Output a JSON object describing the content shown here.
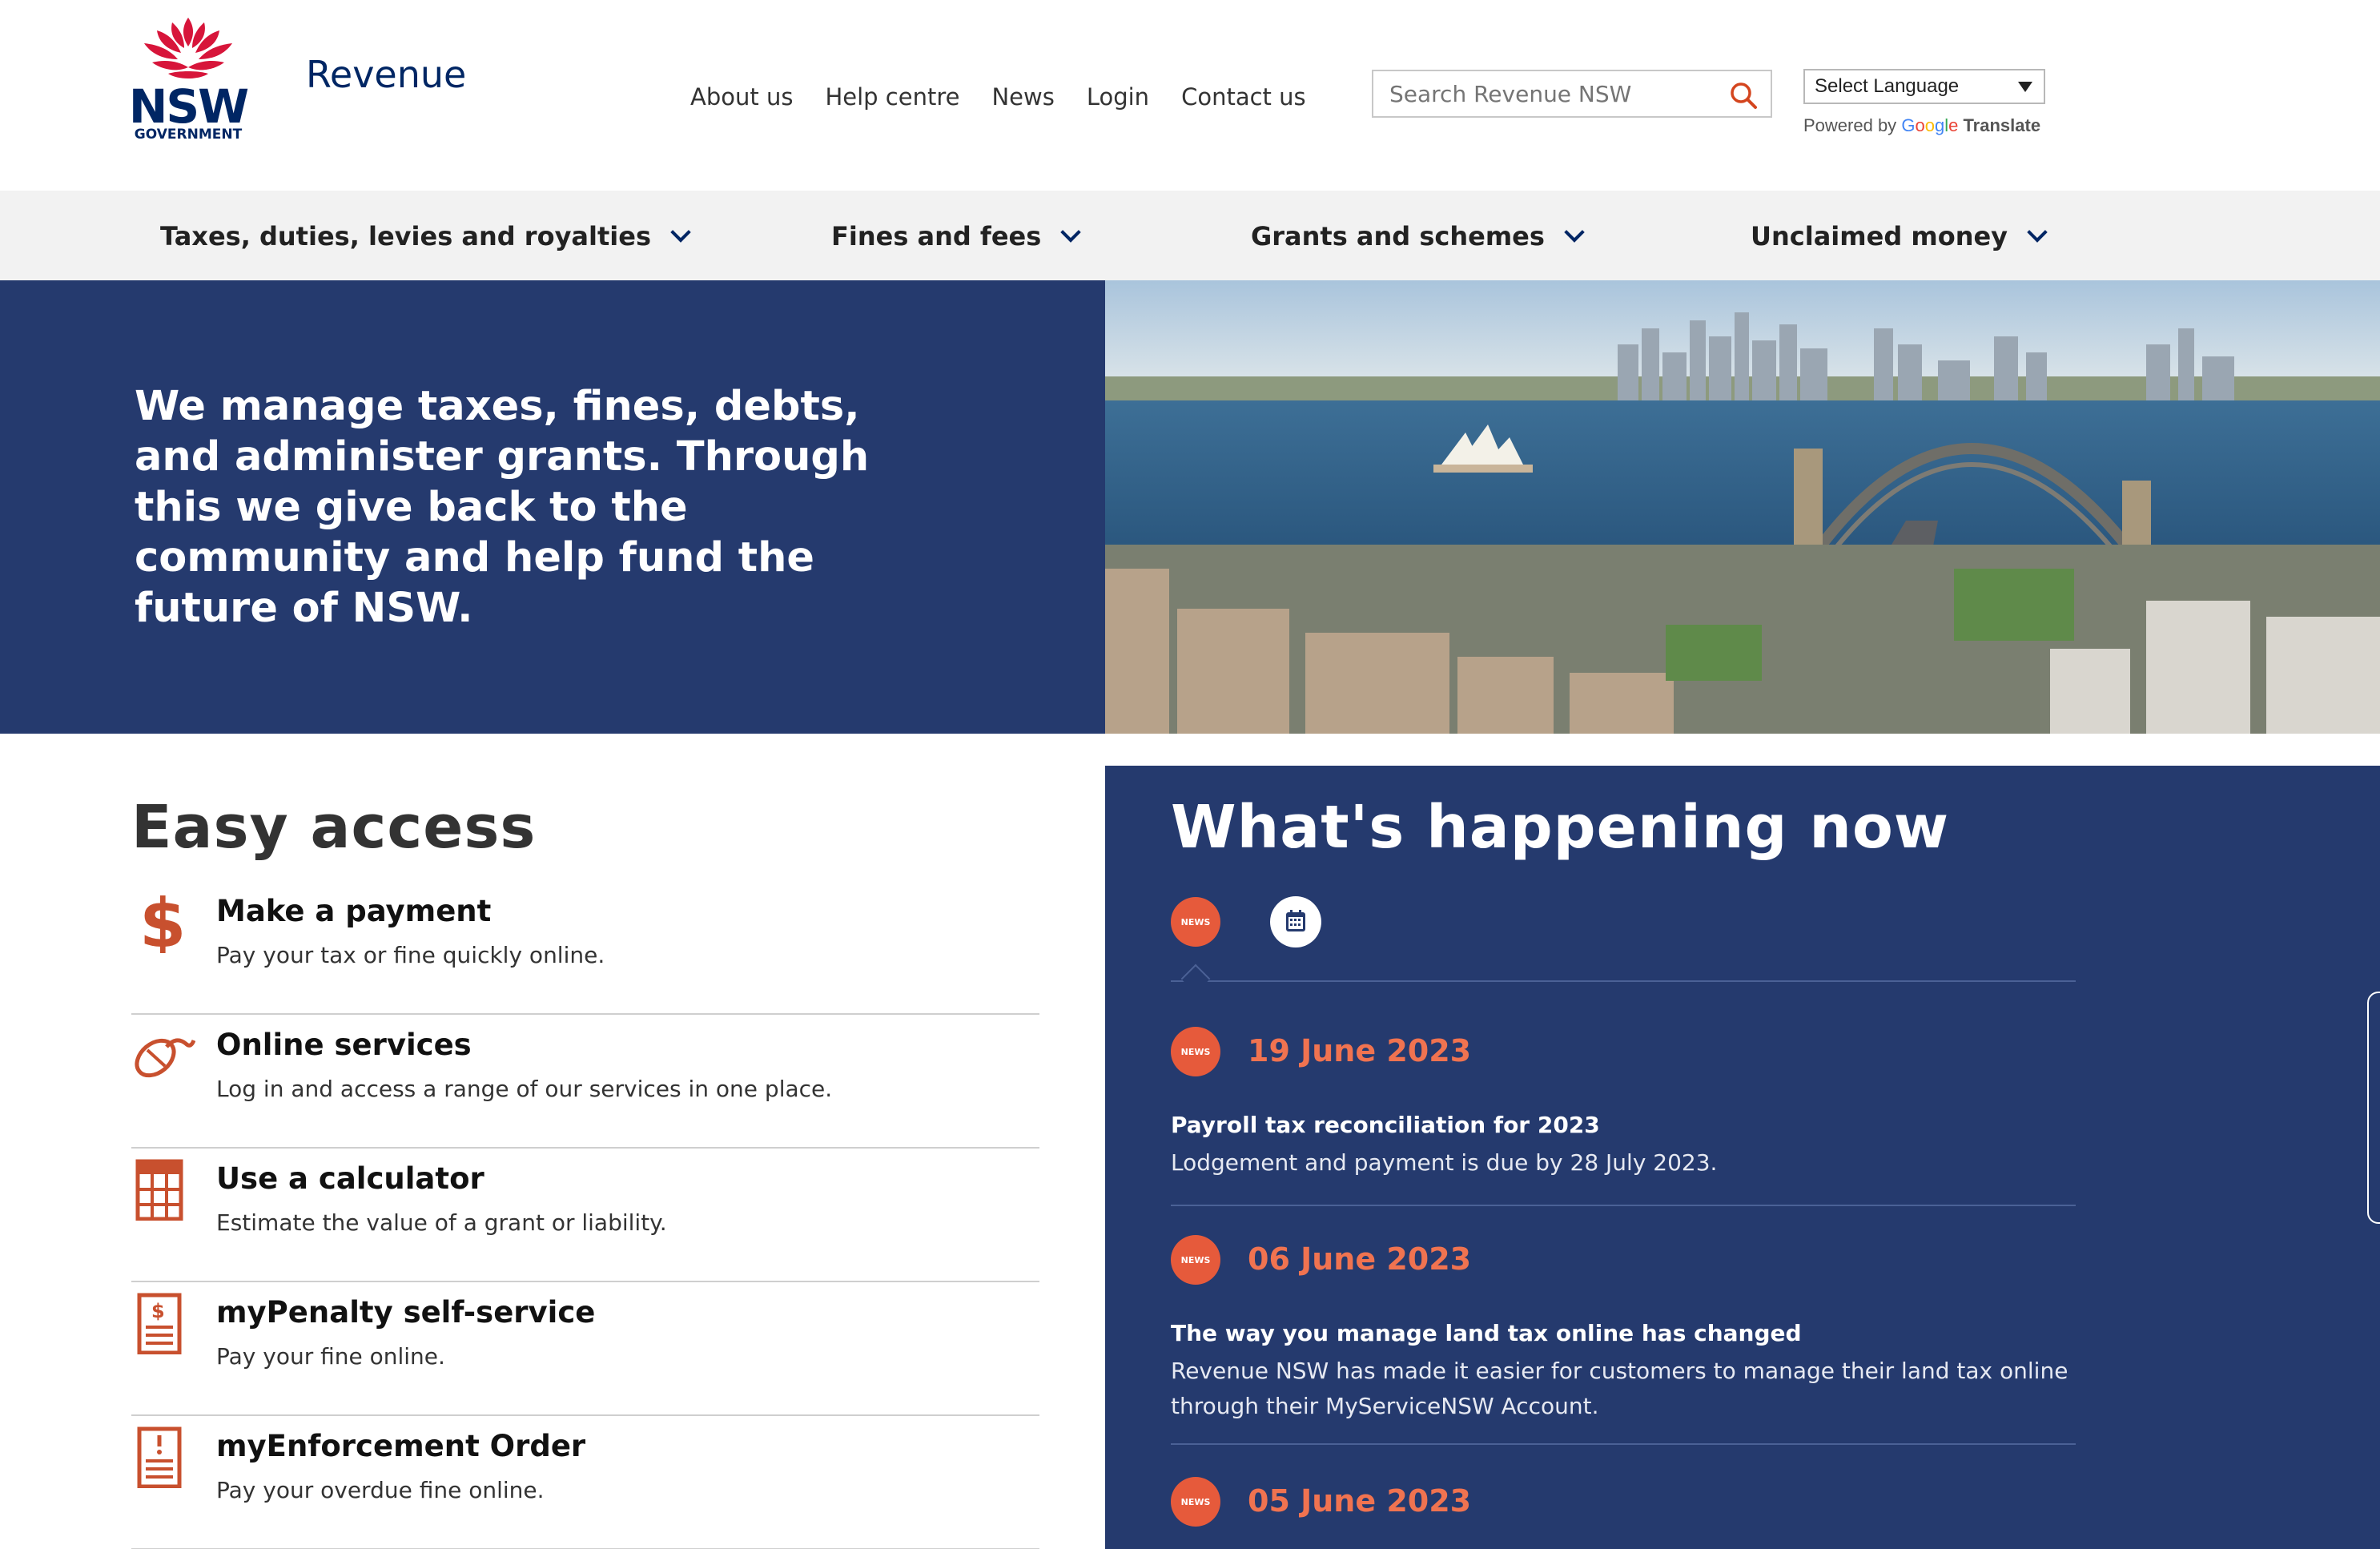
{
  "brand": {
    "logo_text": "NSW",
    "logo_subtext": "GOVERNMENT",
    "site_name": "Revenue"
  },
  "topnav": {
    "items": [
      "About us",
      "Help centre",
      "News",
      "Login",
      "Contact us"
    ]
  },
  "search": {
    "placeholder": "Search Revenue NSW",
    "icon": "search-icon"
  },
  "translate": {
    "select_label": "Select Language",
    "powered_by": "Powered by",
    "google": "Google",
    "translate": "Translate"
  },
  "mainnav": {
    "items": [
      "Taxes, duties, levies and royalties",
      "Fines and fees",
      "Grants and schemes",
      "Unclaimed money"
    ]
  },
  "hero": {
    "heading": "We manage taxes, fines, debts, and administer grants. Through this we give back to the community and help fund the future of NSW."
  },
  "easy_access": {
    "heading": "Easy access",
    "items": [
      {
        "title": "Make a payment",
        "desc": "Pay your tax or fine quickly online.",
        "icon": "dollar-icon"
      },
      {
        "title": "Online services",
        "desc": "Log in and access a range of our services in one place.",
        "icon": "mouse-icon"
      },
      {
        "title": "Use a calculator",
        "desc": "Estimate the value of a grant or liability.",
        "icon": "calculator-icon"
      },
      {
        "title": "myPenalty self-service",
        "desc": "Pay your fine online.",
        "icon": "invoice-icon"
      },
      {
        "title": "myEnforcement Order",
        "desc": "Pay your overdue fine online.",
        "icon": "alert-document-icon"
      }
    ]
  },
  "whats_happening": {
    "heading": "What's happening now",
    "tab_news": "NEWS",
    "tab_events_icon": "calendar-icon",
    "news": [
      {
        "badge": "NEWS",
        "date": "19 June 2023",
        "title": "Payroll tax reconciliation for 2023",
        "desc": "Lodgement and payment is due by 28 July 2023."
      },
      {
        "badge": "NEWS",
        "date": "06 June 2023",
        "title": "The way you manage land tax online has changed",
        "desc": "Revenue NSW has made it easier for customers to manage their land tax online through their MyServiceNSW Account."
      },
      {
        "badge": "NEWS",
        "date": "05 June 2023"
      }
    ]
  },
  "colors": {
    "navy": "#253a6e",
    "brand_blue": "#002664",
    "accent_orange": "#e65a3b",
    "waratah_red": "#d7153a"
  }
}
